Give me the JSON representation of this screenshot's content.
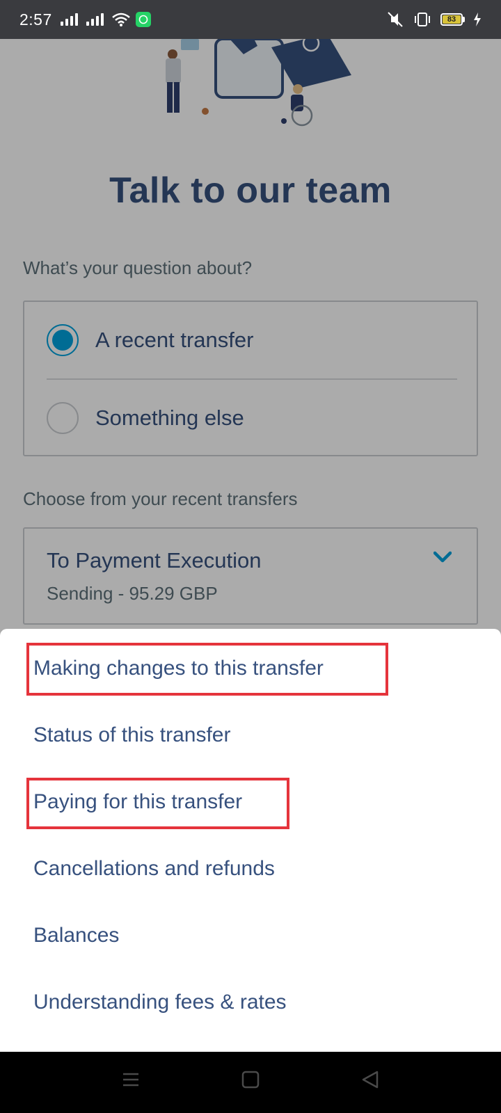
{
  "status_bar": {
    "time": "2:57",
    "battery": "83",
    "icons": [
      "signal-icon",
      "signal-icon",
      "wifi-icon",
      "whatsapp-icon",
      "mute-icon",
      "vibrate-icon",
      "battery-icon",
      "charging-icon"
    ]
  },
  "page": {
    "title": "Talk to our team",
    "question_label": "What’s your question about?",
    "radio_options": [
      {
        "label": "A recent transfer",
        "checked": true
      },
      {
        "label": "Something else",
        "checked": false
      }
    ],
    "transfers_label": "Choose from your recent transfers",
    "selected_transfer": {
      "title": "To Payment Execution",
      "subtitle": "Sending - 95.29 GBP"
    }
  },
  "sheet": {
    "options": [
      {
        "label": "Making changes to this transfer",
        "highlighted": true
      },
      {
        "label": "Status of this transfer",
        "highlighted": false
      },
      {
        "label": "Paying for this transfer",
        "highlighted": true
      },
      {
        "label": "Cancellations and refunds",
        "highlighted": false
      },
      {
        "label": "Balances",
        "highlighted": false
      },
      {
        "label": "Understanding fees & rates",
        "highlighted": false
      }
    ]
  },
  "colors": {
    "accent": "#00a2dd",
    "heading": "#37517e",
    "muted": "#5d7079",
    "highlight_box": "#e5343c"
  }
}
